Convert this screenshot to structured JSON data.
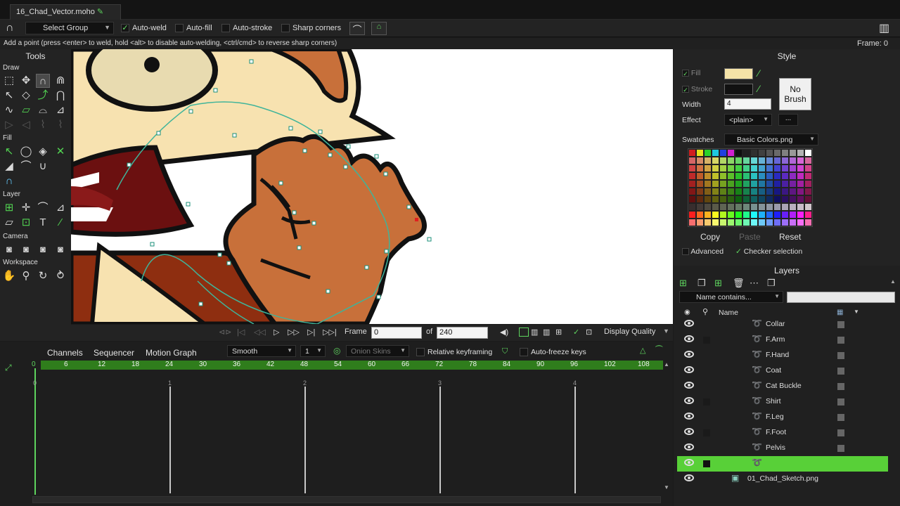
{
  "tab": {
    "title": "16_Chad_Vector.moho"
  },
  "options": {
    "select_group": "Select Group",
    "auto_weld": "Auto-weld",
    "auto_fill": "Auto-fill",
    "auto_stroke": "Auto-stroke",
    "sharp_corners": "Sharp corners"
  },
  "status": {
    "message": "Add a point (press <enter> to weld, hold <alt> to disable auto-welding, <ctrl/cmd> to reverse sharp corners)",
    "frame": "Frame: 0"
  },
  "tools": {
    "title": "Tools",
    "sections": {
      "draw": "Draw",
      "fill": "Fill",
      "layer": "Layer",
      "camera": "Camera",
      "workspace": "Workspace"
    }
  },
  "playback": {
    "frame_label": "Frame",
    "frame_value": "0",
    "of_label": "of",
    "total_value": "240",
    "display_quality": "Display Quality"
  },
  "timeline": {
    "tabs": [
      "Channels",
      "Sequencer",
      "Motion Graph"
    ],
    "interp": "Smooth",
    "interval": "1",
    "onion_skins": "Onion Skins",
    "relative_keyframing": "Relative keyframing",
    "auto_freeze": "Auto-freeze keys",
    "ruler": [
      "6",
      "12",
      "18",
      "24",
      "30",
      "36",
      "42",
      "48",
      "54",
      "60",
      "66",
      "72",
      "78",
      "84",
      "90",
      "96",
      "102",
      "108"
    ],
    "ruler_start": "0",
    "graph_labels": [
      "0",
      "1",
      "2",
      "3",
      "4"
    ]
  },
  "style": {
    "title": "Style",
    "fill": "Fill",
    "stroke": "Stroke",
    "width_label": "Width",
    "width_value": "4",
    "effect_label": "Effect",
    "effect_value": "<plain>",
    "effect_more": "...",
    "no_brush": "No Brush",
    "swatches_label": "Swatches",
    "swatches_value": "Basic Colors.png",
    "copy": "Copy",
    "paste": "Paste",
    "reset": "Reset",
    "advanced": "Advanced",
    "checker": "Checker selection",
    "fill_color": "#f5e3a8",
    "stroke_color": "#111111"
  },
  "layers": {
    "title": "Layers",
    "filter_placeholder": "Name contains...",
    "name_header": "Name",
    "items": [
      {
        "name": "Collar"
      },
      {
        "name": "F.Arm"
      },
      {
        "name": "F.Hand"
      },
      {
        "name": "Coat"
      },
      {
        "name": "Cat Buckle"
      },
      {
        "name": "Shirt"
      },
      {
        "name": "F.Leg"
      },
      {
        "name": "F.Foot"
      },
      {
        "name": "Pelvis"
      },
      {
        "name": ""
      },
      {
        "name": "01_Chad_Sketch.png"
      }
    ]
  },
  "colors": {
    "accent": "#58d038",
    "ruler": "#2f7d1c",
    "skin": "#f7e2b0",
    "beard": "#c8703a"
  }
}
